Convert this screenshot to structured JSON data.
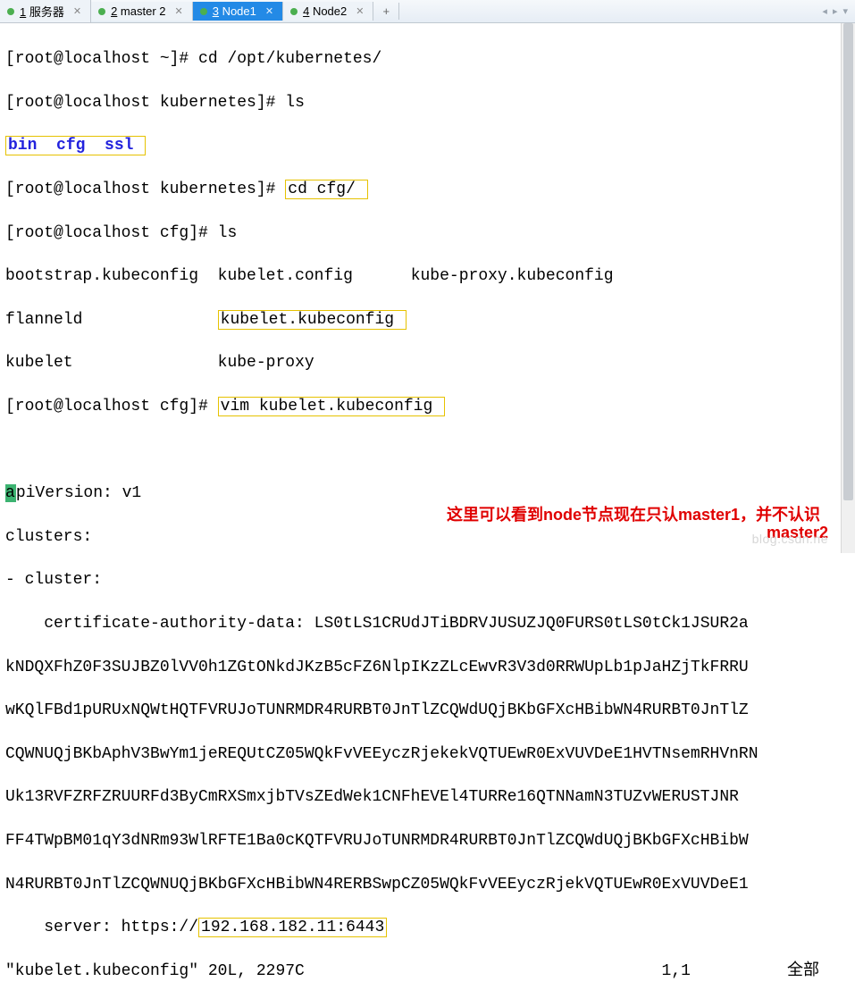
{
  "tabs": {
    "items": [
      {
        "num": "1",
        "label": " 服务器"
      },
      {
        "num": "2",
        "label": " master 2"
      },
      {
        "num": "3",
        "label": " Node1"
      },
      {
        "num": "4",
        "label": " Node2"
      }
    ],
    "add": "+",
    "nav_left": "◂",
    "nav_right": "▸",
    "nav_menu": "▾"
  },
  "term": {
    "l1_prompt": "[root@localhost ~]# ",
    "l1_cmd": "cd /opt/kubernetes/",
    "l2_prompt": "[root@localhost kubernetes]# ",
    "l2_cmd": "ls",
    "l3_bin": "bin",
    "l3_cfg": "cfg",
    "l3_ssl": "ssl",
    "l4_prompt": "[root@localhost kubernetes]# ",
    "l4_cmd": "cd cfg/",
    "l5_prompt": "[root@localhost cfg]# ",
    "l5_cmd": "ls",
    "l6_c1": "bootstrap.kubeconfig",
    "l6_c2": "kubelet.config",
    "l6_c3": "kube-proxy.kubeconfig",
    "l7_c1": "flanneld",
    "l7_c2": "kubelet.kubeconfig",
    "l8_c1": "kubelet",
    "l8_c2": "kube-proxy",
    "l9_prompt": "[root@localhost cfg]# ",
    "l9_cmd": "vim kubelet.kubeconfig",
    "apiv_a": "a",
    "apiv_rest": "piVersion: v1",
    "clusters": "clusters:",
    "cluster_dash": "- cluster:",
    "cert_line": "    certificate-authority-data: LS0tLS1CRUdJTiBDRVJUSUZJQ0FURS0tLS0tCk1JSUR2a",
    "cert_l2": "kNDQXFhZ0F3SUJBZ0lVV0h1ZGtONkdJKzB5cFZ6NlpIKzZLcEwvR3V3d0RRWUpLb1pJaHZjTkFRRU",
    "cert_l3": "wKQlFBd1pURUxNQWtHQTFVRUJoTUNRMDR4RURBT0JnTlZCQWdUQjBKbGFXcHBibWN4RURBT0JnTlZ",
    "cert_l4": "CQWNUQjBKbAphV3BwYm1jeREQUtCZ05WQkFvVEEyczRjekekVQTUEwR0ExVUVDeE1HVTNsemRHVnRN",
    "cert_l5": "Uk13RVFZRFZRUURFd3ByCmRXSmxjbTVsZEdWek1CNFhEVEl4TURRe16QTNNamN3TUZvWERUSTJNR",
    "cert_l6": "FF4TWpBM01qY3dNRm93WlRFTE1Ba0cKQTFVRUJoTUNRMDR4RURBT0JnTlZCQWdUQjBKbGFXcHBibW",
    "cert_l7": "N4RURBT0JnTlZCQWNUQjBKbGFXcHBibWN4RERBSwpCZ05WQkFvVEEyczRjekVQTUEwR0ExVUVDeE1",
    "server_pre": "    server: https://",
    "server_ip": "192.168.182.11:6443",
    "status_file": "\"kubelet.kubeconfig\" 20L, 2297C",
    "status_pos": "1,1",
    "status_end": "全部"
  },
  "annotation": {
    "line1": "这里可以看到node节点现在只认master1，并不认识",
    "line2": "master2"
  },
  "watermark": "blog.csdn.ne"
}
